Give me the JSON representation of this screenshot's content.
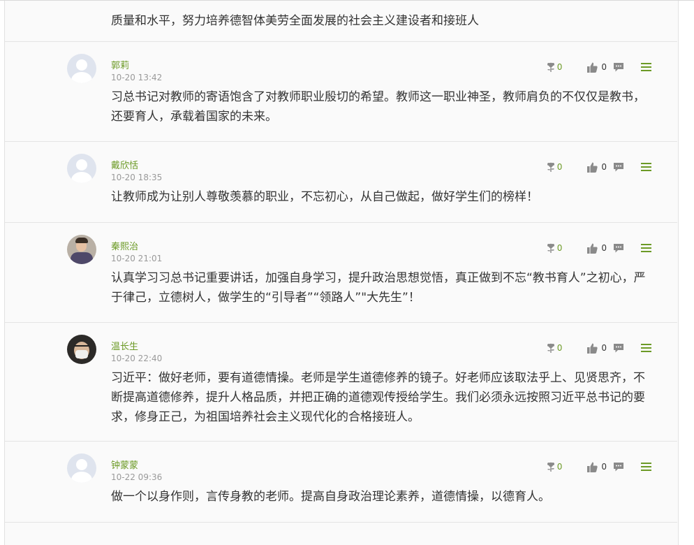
{
  "partial_comment": {
    "text_line2": "质量和水平，努力培养德智体美劳全面发展的社会主义建设者和接班人"
  },
  "comments": [
    {
      "user": "郭莉",
      "time": "10-20 13:42",
      "avatar": "default",
      "text": "习总书记对教师的寄语饱含了对教师职业殷切的希望。教师这一职业神圣，教师肩负的不仅仅是教书，还要育人，承载着国家的未来。",
      "flowers": "0",
      "likes": "0"
    },
    {
      "user": "戴欣恬",
      "time": "10-20 18:35",
      "avatar": "default",
      "text": "让教师成为让别人尊敬羡慕的职业，不忘初心，从自己做起，做好学生们的榜样！",
      "flowers": "0",
      "likes": "0"
    },
    {
      "user": "秦熙治",
      "time": "10-20 21:01",
      "avatar": "photo",
      "text": "认真学习习总书记重要讲话，加强自身学习，提升政治思想觉悟，真正做到不忘“教书育人”之初心，严于律己，立德树人，做学生的“引导者”“领路人”\"大先生”！",
      "flowers": "0",
      "likes": "0"
    },
    {
      "user": "温长生",
      "time": "10-20 22:40",
      "avatar": "photo",
      "text": "习近平：做好老师，要有道德情操。老师是学生道德修养的镜子。好老师应该取法乎上、见贤思齐，不断提高道德修养，提升人格品质，并把正确的道德观传授给学生。我们必须永远按照习近平总书记的要求，修身正己，为祖国培养社会主义现代化的合格接班人。",
      "flowers": "0",
      "likes": "0"
    },
    {
      "user": "钟蒙蒙",
      "time": "10-22 09:36",
      "avatar": "default",
      "text": "做一个以身作则，言传身教的老师。提高自身政治理论素养，道德情操，以德育人。",
      "flowers": "0",
      "likes": "0"
    }
  ],
  "icons": {
    "flower": "flower-icon",
    "like": "thumbs-up-icon",
    "reply": "comment-bubble-icon",
    "menu": "hamburger-menu-icon"
  },
  "colors": {
    "accent_green": "#6c9a26",
    "icon_gray": "#8a8a8a",
    "time_gray": "#9a9a9a",
    "text": "#333333"
  }
}
